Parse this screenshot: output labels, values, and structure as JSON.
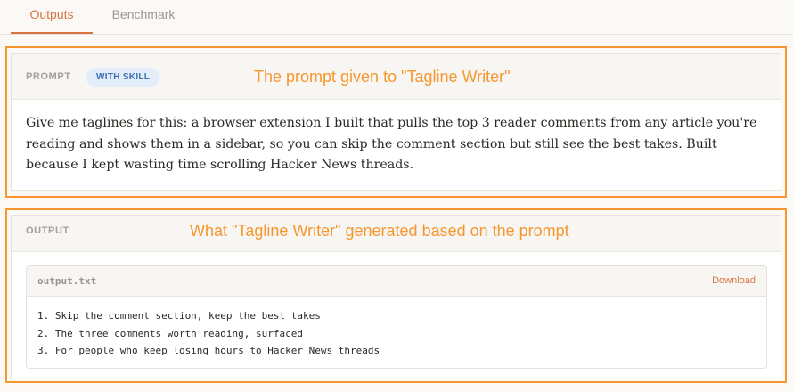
{
  "tabs": [
    {
      "label": "Outputs",
      "active": true
    },
    {
      "label": "Benchmark",
      "active": false
    }
  ],
  "prompt_section": {
    "label": "PROMPT",
    "badge": "WITH SKILL",
    "annotation": "The prompt given to \"Tagline Writer\"",
    "text": "Give me taglines for this: a browser extension I built that pulls the top 3 reader comments from any article you're reading and shows them in a sidebar, so you can skip the comment section but still see the best takes. Built because I kept wasting time scrolling Hacker News threads."
  },
  "output_section": {
    "label": "OUTPUT",
    "annotation": "What \"Tagline Writer\" generated based on the prompt",
    "file": {
      "name": "output.txt",
      "download_label": "Download",
      "lines": [
        "1. Skip the comment section, keep the best takes",
        "2. The three comments worth reading, surfaced",
        "3. For people who keep losing hours to Hacker News threads"
      ]
    }
  },
  "colors": {
    "accent": "#d9743f",
    "annotation": "#f7962e",
    "badge_bg": "#e2edf9",
    "badge_text": "#3e72b3"
  }
}
